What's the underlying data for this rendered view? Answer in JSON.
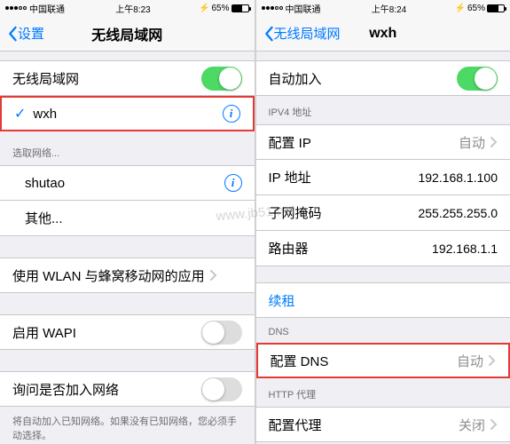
{
  "left": {
    "status": {
      "carrier": "中国联通",
      "time": "上午8:23",
      "battery": "65%"
    },
    "nav": {
      "back": "设置",
      "title": "无线局域网"
    },
    "wifi_toggle_label": "无线局域网",
    "connected": {
      "name": "wxh"
    },
    "choose_header": "选取网络...",
    "networks": [
      {
        "name": "shutao"
      }
    ],
    "other": "其他...",
    "wlan_cell": "使用 WLAN 与蜂窝移动网的应用",
    "wapi": "启用 WAPI",
    "ask_join": "询问是否加入网络",
    "ask_note": "将自动加入已知网络。如果没有已知网络，您必须手动选择。"
  },
  "right": {
    "status": {
      "carrier": "中国联通",
      "time": "上午8:24",
      "battery": "65%"
    },
    "nav": {
      "back": "无线局域网",
      "title": "wxh"
    },
    "auto_join": "自动加入",
    "ipv4_header": "IPV4 地址",
    "config_ip": {
      "label": "配置 IP",
      "value": "自动"
    },
    "ip": {
      "label": "IP 地址",
      "value": "192.168.1.100"
    },
    "mask": {
      "label": "子网掩码",
      "value": "255.255.255.0"
    },
    "router": {
      "label": "路由器",
      "value": "192.168.1.1"
    },
    "renew": "续租",
    "dns_header": "DNS",
    "config_dns": {
      "label": "配置 DNS",
      "value": "自动"
    },
    "http_header": "HTTP 代理",
    "proxy": {
      "label": "配置代理",
      "value": "关闭"
    }
  },
  "watermark": "www.jb51.net"
}
